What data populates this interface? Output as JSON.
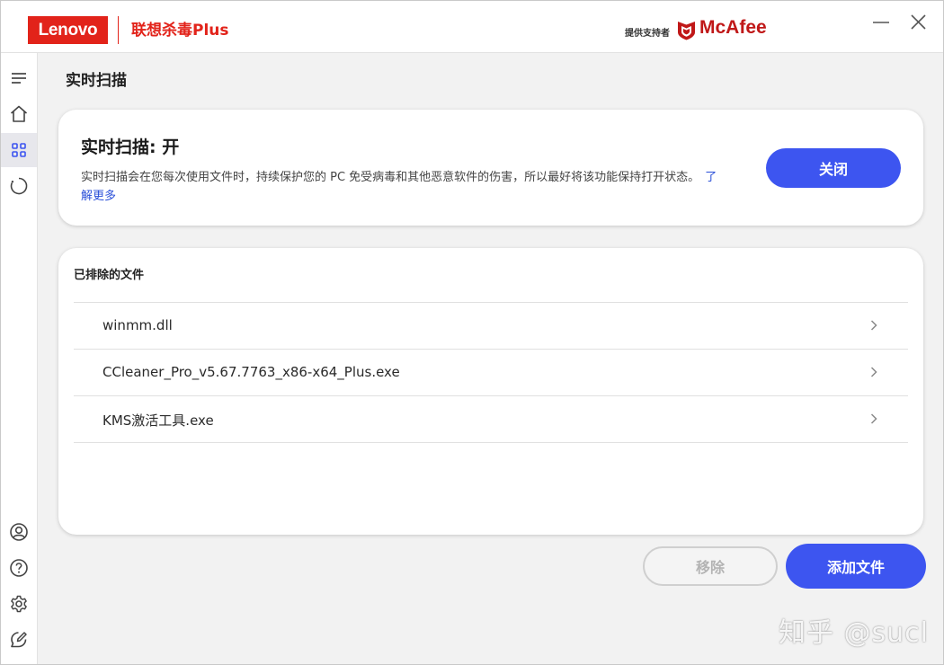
{
  "titlebar": {
    "brand": "Lenovo",
    "product": "联想杀毒Plus",
    "powered_by": "提供支持者",
    "partner": "McAfee",
    "brand_color": "#e2231a",
    "partner_color": "#c01818"
  },
  "sidebar": {
    "items": [
      {
        "name": "menu",
        "icon": "menu-icon"
      },
      {
        "name": "home",
        "icon": "home-icon"
      },
      {
        "name": "apps",
        "icon": "grid-icon",
        "active": true
      },
      {
        "name": "scan",
        "icon": "refresh-circle-icon"
      },
      {
        "name": "account",
        "icon": "user-icon"
      },
      {
        "name": "help",
        "icon": "help-icon"
      },
      {
        "name": "settings",
        "icon": "gear-icon"
      },
      {
        "name": "feedback",
        "icon": "feedback-icon"
      }
    ]
  },
  "page": {
    "title": "实时扫描"
  },
  "scan_card": {
    "title": "实时扫描: 开",
    "description": "实时扫描会在您每次使用文件时，持续保护您的 PC 免受病毒和其他恶意软件的伤害，所以最好将该功能保持打开状态。",
    "learn_more": "了解更多",
    "toggle_button": "关闭"
  },
  "exclusions": {
    "title": "已排除的文件",
    "files": [
      "winmm.dll",
      "CCleaner_Pro_v5.67.7763_x86-x64_Plus.exe",
      "KMS激活工具.exe"
    ]
  },
  "actions": {
    "remove": "移除",
    "add_file": "添加文件"
  },
  "watermark": "知乎 @sucl",
  "accent_color": "#3d55f0"
}
